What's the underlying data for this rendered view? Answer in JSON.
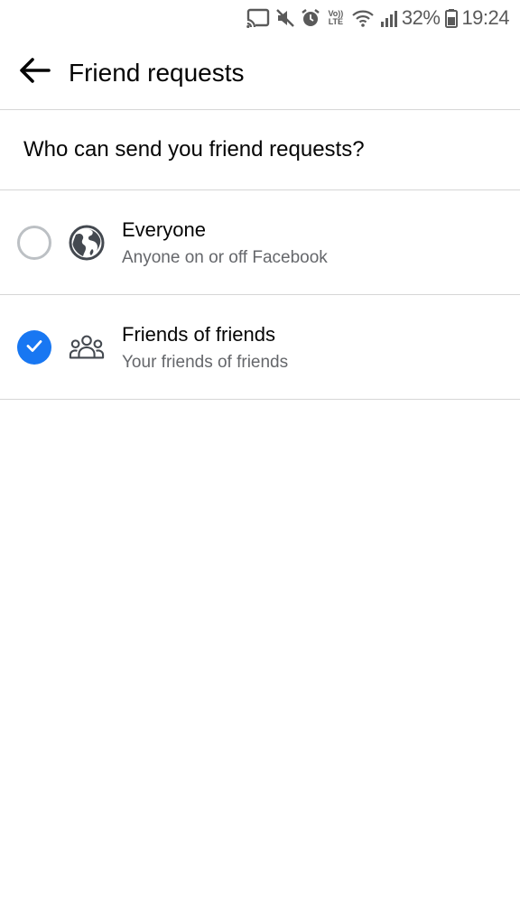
{
  "status_bar": {
    "volte_top": "Vo))",
    "volte_bottom": "LTE",
    "battery": "32%",
    "time": "19:24",
    "icons": [
      "cast-icon",
      "mute-icon",
      "alarm-icon",
      "volte-icon",
      "wifi-icon",
      "signal-icon",
      "battery-icon"
    ]
  },
  "header": {
    "title": "Friend requests",
    "back_icon": "arrow-left-icon"
  },
  "question": "Who can send you friend requests?",
  "options": [
    {
      "title": "Everyone",
      "subtitle": "Anyone on or off Facebook",
      "icon": "globe-icon",
      "selected": false
    },
    {
      "title": "Friends of friends",
      "subtitle": "Your friends of friends",
      "icon": "people-group-icon",
      "selected": true
    }
  ],
  "colors": {
    "accent": "#1877f2",
    "secondary_text": "#65676b",
    "divider": "#d6d6d6"
  }
}
